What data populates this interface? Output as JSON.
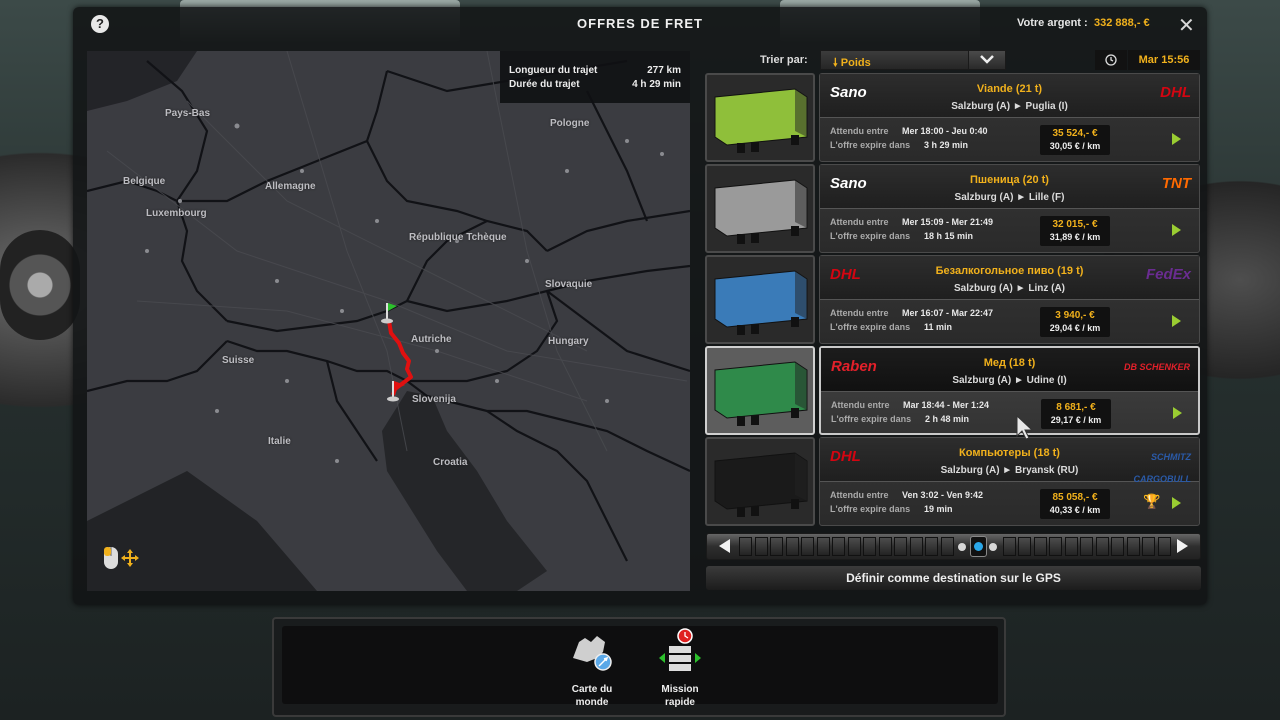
{
  "window": {
    "title": "OFFRES DE FRET",
    "help": "?",
    "money_label": "Votre argent :",
    "money_value": "332 888,- €",
    "close": "✕"
  },
  "route_info": {
    "length_label": "Longueur du trajet",
    "length_value": "277 km",
    "duration_label": "Durée du trajet",
    "duration_value": "4 h 29 min"
  },
  "map_labels": {
    "pays_bas": "Pays-Bas",
    "pologne": "Pologne",
    "belgique": "Belgique",
    "allemagne": "Allemagne",
    "luxembourg": "Luxembourg",
    "rep_tcheque": "République Tchèque",
    "slovaquie": "Slovaquie",
    "autriche": "Autriche",
    "hongrie": "Hungary",
    "suisse": "Suisse",
    "slovenija": "Slovenija",
    "italie": "Italie",
    "croatia": "Croatia"
  },
  "sort": {
    "label": "Trier par:",
    "value": "Poids",
    "arrow": "⌄"
  },
  "clock": {
    "time": "Mar 15:56",
    "icon": "clock-icon"
  },
  "offers": [
    {
      "logo_left": "Sano",
      "logo_left_color": "#ffffff",
      "cargo": "Viande (21 t)",
      "route": "Salzburg (A) ► Puglia (I)",
      "logo_right": "DHL",
      "logo_right_color": "#d40511",
      "time_label": "Attendu entre",
      "time_value": "Mer 18:00 - Jeu 0:40",
      "expire_label": "L'offre expire dans",
      "expire_value": "3 h 29 min",
      "price": "35 524,- €",
      "per_km": "30,05 € / km",
      "trailer_color": "#8fbf3a"
    },
    {
      "logo_left": "Sano",
      "logo_left_color": "#ffffff",
      "cargo": "Пшеница (20 t)",
      "route": "Salzburg (A) ► Lille (F)",
      "logo_right": "TNT",
      "logo_right_color": "#ff6a00",
      "time_label": "Attendu entre",
      "time_value": "Mer 15:09 - Mer 21:49",
      "expire_label": "L'offre expire dans",
      "expire_value": "18 h 15 min",
      "price": "32 015,- €",
      "per_km": "31,89 € / km",
      "trailer_color": "#9a9a9a"
    },
    {
      "logo_left": "DHL",
      "logo_left_color": "#d40511",
      "cargo": "Безалкогольное пиво (19 t)",
      "route": "Salzburg (A) ► Linz (A)",
      "logo_right": "FedEx",
      "logo_right_color": "#6a2c91",
      "time_label": "Attendu entre",
      "time_value": "Mer 16:07 - Mar 22:47",
      "expire_label": "L'offre expire dans",
      "expire_value": "11 min",
      "price": "3 940,- €",
      "per_km": "29,04 € / km",
      "trailer_color": "#3a7bb8"
    },
    {
      "logo_left": "Raben",
      "logo_left_color": "#e2202a",
      "cargo": "Мед (18 t)",
      "route": "Salzburg (A) ► Udine (I)",
      "logo_right": "DB SCHENKER",
      "logo_right_color": "#e2202a",
      "time_label": "Attendu entre",
      "time_value": "Mar 18:44 - Mer 1:24",
      "expire_label": "L'offre expire dans",
      "expire_value": "2 h 48 min",
      "price": "8 681,- €",
      "per_km": "29,17 € / km",
      "trailer_color": "#2f8a4a"
    },
    {
      "logo_left": "DHL",
      "logo_left_color": "#d40511",
      "cargo": "Компьютеры (18 t)",
      "route": "Salzburg (A) ► Bryansk (RU)",
      "logo_right": "SCHMITZ CARGOBULL",
      "logo_right_color": "#2a5aa8",
      "time_label": "Attendu entre",
      "time_value": "Ven 3:02 - Ven 9:42",
      "expire_label": "L'offre expire dans",
      "expire_value": "19 min",
      "price": "85 058,- €",
      "per_km": "40,33 € / km",
      "trailer_color": "#1a1a1a"
    }
  ],
  "gps_button": "Définir comme destination sur le GPS",
  "bottom": {
    "world_map": "Carte du monde",
    "quick_job": "Mission rapide"
  },
  "colors": {
    "accent": "#f1b11c",
    "route": "#e01010"
  }
}
